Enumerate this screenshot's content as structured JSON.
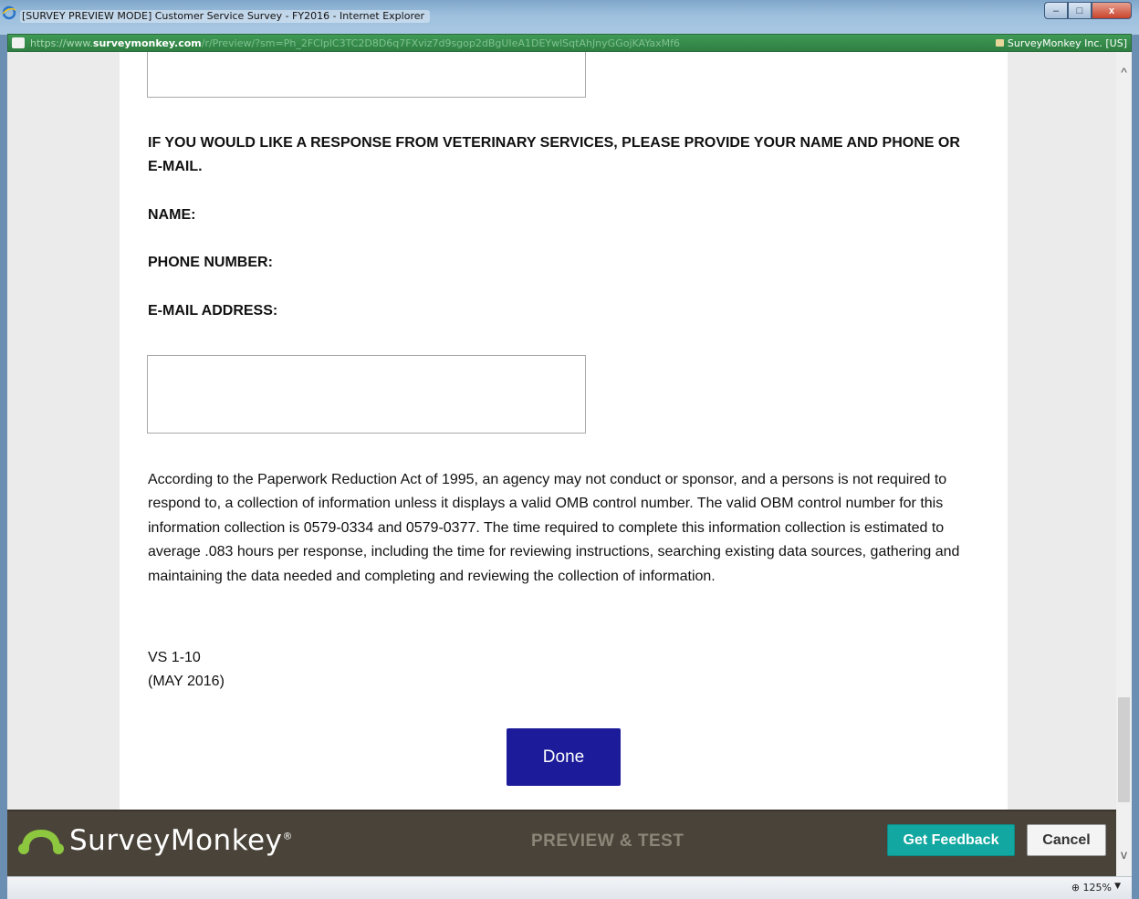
{
  "window": {
    "title": "[SURVEY PREVIEW MODE] Customer Service Survey - FY2016 - Internet Explorer",
    "minimize_label": "–",
    "maximize_label": "□",
    "close_label": "x"
  },
  "address": {
    "scheme": "https://",
    "www": "www.",
    "host": "surveymonkey.com",
    "path": "/r/Preview/?sm=Ph_2FClplC3TC2D8D6q7FXviz7d9sgop2dBgUIeA1DEYwlSqtAhJnyGGojKAYaxMf6",
    "cert": "SurveyMonkey Inc. [US]"
  },
  "survey": {
    "response_prompt": "IF YOU WOULD LIKE A RESPONSE FROM VETERINARY SERVICES, PLEASE PROVIDE YOUR NAME AND PHONE OR E-MAIL.",
    "name_label": "NAME:",
    "phone_label": "PHONE NUMBER:",
    "email_label": "E-MAIL ADDRESS:",
    "paperwork_notice": "According to the Paperwork Reduction Act of 1995, an agency may not conduct or sponsor, and a persons is not required to respond to, a collection of information unless it displays a valid OMB control number. The valid OBM control number for this information collection is 0579-0334 and 0579-0377. The time required to complete this information collection is estimated to average .083 hours per response, including the time for reviewing instructions, searching existing data sources, gathering and maintaining the data needed and completing and reviewing the collection of information.",
    "form_id": "VS 1-10",
    "form_date": "(MAY 2016)",
    "done_label": "Done"
  },
  "preview_bar": {
    "brand": "SurveyMonkey",
    "brand_mark": "®",
    "mode_label": "PREVIEW & TEST",
    "feedback_label": "Get Feedback",
    "cancel_label": "Cancel"
  },
  "status": {
    "zoom": "125%"
  },
  "colors": {
    "done_button": "#1c1c9a",
    "feedback_button": "#12a7a0",
    "preview_bar": "#4a4339",
    "address_bar": "#2e7e42"
  },
  "icons": [
    "internet-explorer-icon",
    "site-icon",
    "lock-icon",
    "surveymonkey-logo-icon",
    "zoom-icon"
  ]
}
